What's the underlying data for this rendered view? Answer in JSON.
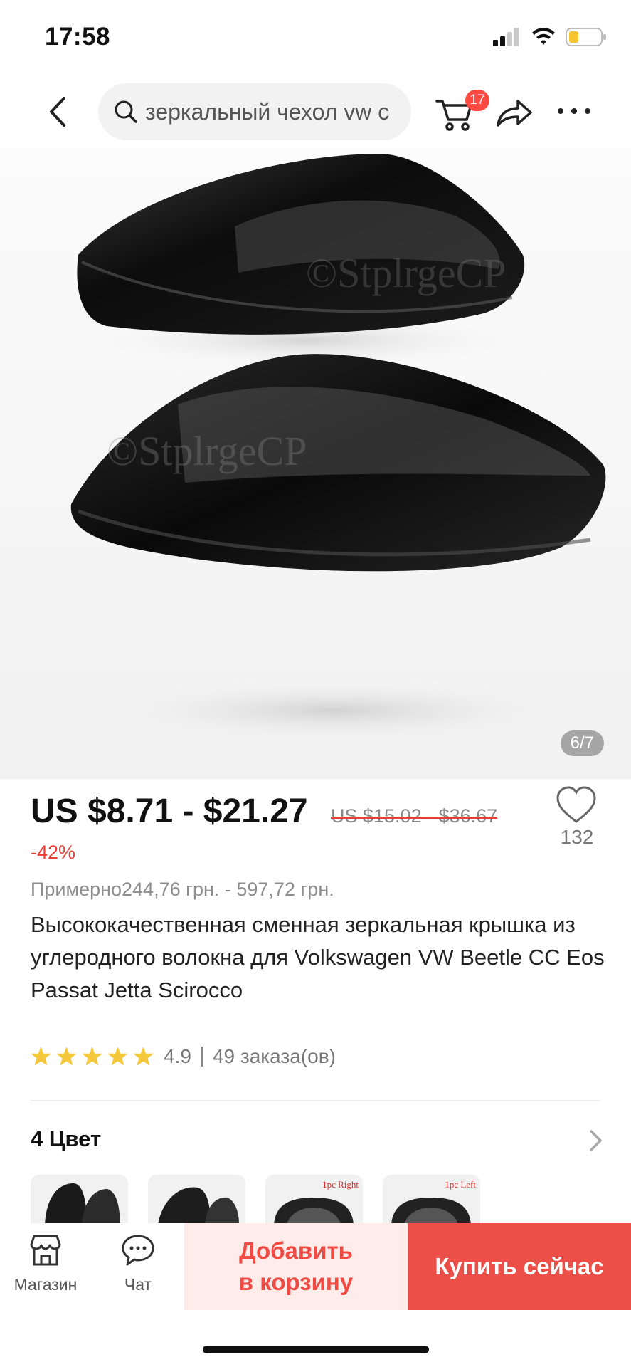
{
  "status_bar": {
    "time": "17:58"
  },
  "header": {
    "search_query": "зеркальный чехол vw c",
    "cart_count": "17"
  },
  "gallery": {
    "counter": "6/7",
    "watermark": "©StplrgeCP"
  },
  "product": {
    "price": "US $8.71 - $21.27",
    "old_price": "US $15.02 - $36.67",
    "discount": "-42%",
    "approx_price": "Примерно244,76 грн. - 597,72 грн.",
    "wishlist_count": "132",
    "title": "Высококачественная сменная зеркальная крышка из углеродного волокна для Volkswagen VW Beetle CC Eos Passat Jetta Scirocco",
    "rating": "4.9",
    "orders": "49 заказа(ов)"
  },
  "colors": {
    "title": "4 Цвет",
    "swatches": [
      {
        "tag": ""
      },
      {
        "tag": ""
      },
      {
        "tag": "1pc Right"
      },
      {
        "tag": "1pc Left"
      }
    ]
  },
  "bottom_bar": {
    "store_label": "Магазин",
    "chat_label": "Чат",
    "add_to_cart_line1": "Добавить",
    "add_to_cart_line2": "в корзину",
    "buy_now": "Купить сейчас"
  },
  "colors_palette": {
    "accent": "#ec4f48",
    "accent_light": "#fdecea",
    "star": "#f5c83b",
    "muted_text": "#8d8d8d"
  }
}
